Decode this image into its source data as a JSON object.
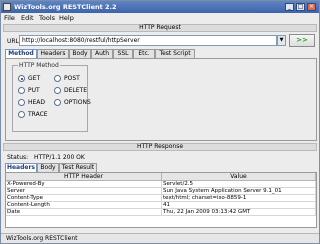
{
  "window": {
    "title": "WizTools.org RESTClient 2.2"
  },
  "menu": [
    "File",
    "Edit",
    "Tools",
    "Help"
  ],
  "request": {
    "header": "HTTP Request",
    "url_label": "URL:",
    "url_value": "http://localhost:8080/restful/httpServer",
    "go_label": ">>",
    "tabs": [
      "Method",
      "Headers",
      "Body",
      "Auth",
      "SSL",
      "Etc.",
      "Test Script"
    ],
    "active_tab": "Method",
    "method_group_title": "HTTP Method",
    "methods": [
      "GET",
      "POST",
      "PUT",
      "DELETE",
      "HEAD",
      "OPTIONS",
      "TRACE"
    ],
    "selected_method": "GET"
  },
  "response": {
    "header": "HTTP Response",
    "status_label": "Status:",
    "status_value": "HTTP/1.1 200 OK",
    "tabs": [
      "Headers",
      "Body",
      "Test Result"
    ],
    "active_tab": "Headers",
    "columns": [
      "HTTP Header",
      "Value"
    ],
    "rows": [
      [
        "X-Powered-By",
        "Servlet/2.5"
      ],
      [
        "Server",
        "Sun Java System Application Server 9.1_01"
      ],
      [
        "Content-Type",
        "text/html; charset=iso-8859-1"
      ],
      [
        "Content-Length",
        "41"
      ],
      [
        "Date",
        "Thu, 22 Jan 2009 03:13:42 GMT"
      ]
    ]
  },
  "statusbar": "WizTools.org RESTClient"
}
